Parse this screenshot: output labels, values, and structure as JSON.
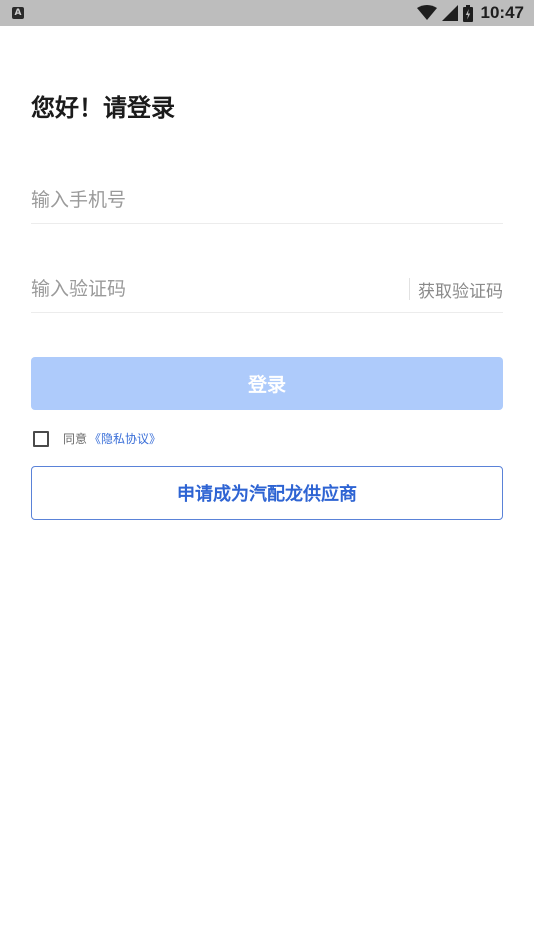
{
  "status_bar": {
    "notification_letter": "A",
    "time": "10:47",
    "icons": [
      "wifi-icon",
      "signal-icon",
      "battery-icon"
    ]
  },
  "login": {
    "title": "您好！请登录",
    "phone_placeholder": "输入手机号",
    "code_placeholder": "输入验证码",
    "get_code_label": "获取验证码",
    "submit_label": "登录",
    "agree_prefix": "同意",
    "privacy_link": "《隐私协议》",
    "apply_label": "申请成为汽配龙供应商"
  },
  "colors": {
    "login_button_bg": "#aecbfb",
    "accent_blue": "#2e64d3",
    "status_bar_bg": "#bdbdbd"
  }
}
